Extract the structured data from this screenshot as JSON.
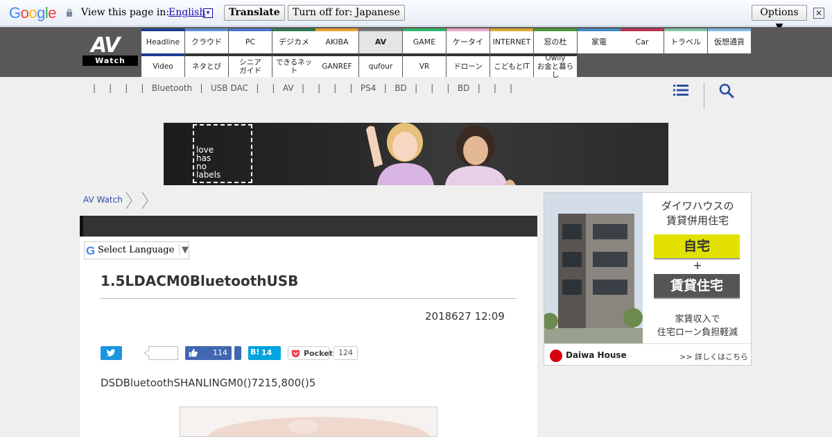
{
  "translate_bar": {
    "logo": [
      "G",
      "o",
      "o",
      "g",
      "l",
      "e"
    ],
    "label": "View this page in:",
    "language": "English",
    "language_arrow": "▾",
    "translate_btn": "Translate",
    "turnoff_btn": "Turn off for: Japanese",
    "options_btn": "Options ▼",
    "close": "✕"
  },
  "header": {
    "logo_top": "AV",
    "logo_bottom": "Watch",
    "nav_row1": [
      {
        "label": "Headline",
        "color": "#1e3d8f"
      },
      {
        "label": "クラウド",
        "color": "#5c8fcf"
      },
      {
        "label": "PC",
        "color": "#4a74c9"
      },
      {
        "label": "デジカメ",
        "color": "#2d7a52"
      },
      {
        "label": "AKIBA",
        "color": "#e5a22e"
      },
      {
        "label": "AV",
        "color": "#777777",
        "active": true
      },
      {
        "label": "GAME",
        "color": "#2eb66a"
      },
      {
        "label": "ケータイ",
        "color": "#e8a7c6"
      },
      {
        "label": "INTERNET",
        "color": "#d8a830"
      },
      {
        "label": "窓の杜",
        "color": "#4a9a3b"
      },
      {
        "label": "家電",
        "color": "#3f89c6"
      },
      {
        "label": "Car",
        "color": "#b8334e"
      },
      {
        "label": "トラベル",
        "color": "#7fc4a4"
      },
      {
        "label": "仮想通貨",
        "color": "#7fb7e0"
      }
    ],
    "nav_row2": [
      {
        "label": "Video",
        "color": "#1e3d8f"
      },
      {
        "label": "ネタとぴ",
        "color": "#333333"
      },
      {
        "label": "シニア\nガイド",
        "color": "#333333"
      },
      {
        "label": "できるネット",
        "color": "#333333"
      },
      {
        "label": "GANREF",
        "color": "#333333"
      },
      {
        "label": "qufour",
        "color": "#333333"
      },
      {
        "label": "VR",
        "color": "#333333"
      },
      {
        "label": "ドローン",
        "color": "#333333"
      },
      {
        "label": "こどもとIT",
        "color": "#333333"
      },
      {
        "label": "Owlly\nお金と暮らし",
        "color": "#333333"
      }
    ]
  },
  "subnav": "|     |     |     |   Bluetooth   |   USB DAC   |     |   AV   |     |     |     |   PS4   |   BD   |     |     |   BD   |     |     |",
  "banner": {
    "text": "love\nhas\nno\nlabels"
  },
  "breadcrumb": {
    "home": "AV Watch"
  },
  "translate_widget": {
    "icon": "G",
    "label": "Select Language",
    "arrow": "▼"
  },
  "article": {
    "title": "1.5LDACM0BluetoothUSB",
    "date": "2018627 12:09",
    "lead": "DSDBluetoothSHANLINGM0()7215,800()5"
  },
  "share": {
    "facebook_count": "114",
    "hatena_label": "B!",
    "hatena_count": "14",
    "pocket_label": "Pocket",
    "pocket_count": "124"
  },
  "ad": {
    "title": "ダイワハウスの\n賃貸併用住宅",
    "home": "自宅",
    "plus": "+",
    "rent": "賃貸住宅",
    "sub": "家賃収入で\n住宅ローン負担軽減",
    "brand": "Daiwa House",
    "more": ">> 詳しくはこちら"
  }
}
